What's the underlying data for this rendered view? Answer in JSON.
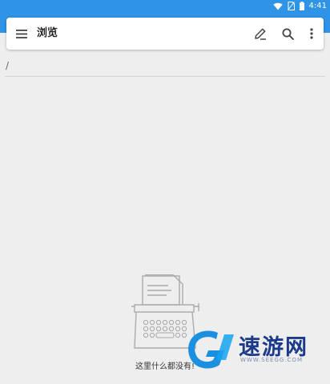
{
  "status_bar": {
    "time": "4:41"
  },
  "toolbar": {
    "title": "浏览",
    "menu_icon": "hamburger-menu-icon",
    "edit_icon": "pencil-icon",
    "search_icon": "search-icon",
    "more_icon": "more-vert-icon"
  },
  "path": "/",
  "empty_state": {
    "message": "这里什么都没有!",
    "icon": "typewriter-icon"
  },
  "watermark": {
    "title": "速游网",
    "url": "WWW.SEEGG.COM"
  },
  "colors": {
    "primary": "#2f93e6",
    "background": "#eeeeee",
    "watermark": "#1b3a8c"
  }
}
